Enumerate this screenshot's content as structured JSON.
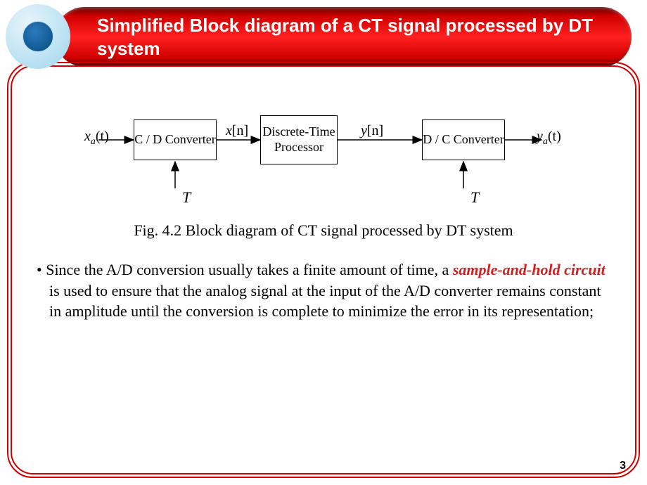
{
  "title": "Simplified Block diagram of a CT signal processed by DT system",
  "diagram": {
    "blocks": {
      "cd": "C  /  D Converter",
      "dt": "Discrete-Time Processor",
      "dc": "D  /  C Converter"
    },
    "signals": {
      "xa": {
        "var": "x",
        "sub": "a",
        "arg": "(t)"
      },
      "xn": {
        "var": "x",
        "arg": "[n]"
      },
      "yn": {
        "var": "y",
        "arg": "[n]"
      },
      "ya": {
        "var": "y",
        "sub": "a",
        "arg": "(t)"
      }
    },
    "period": "T"
  },
  "caption": "Fig. 4.2 Block diagram of CT signal processed by DT system",
  "body": {
    "bullet": "•",
    "pre": " Since the A/D conversion usually takes a finite amount of time, a ",
    "emph": "sample-and-hold circuit",
    "post": " is used to ensure that the analog signal at the input of the A/D converter remains constant in amplitude until the conversion is complete to minimize the error in its representation;"
  },
  "page": "3"
}
